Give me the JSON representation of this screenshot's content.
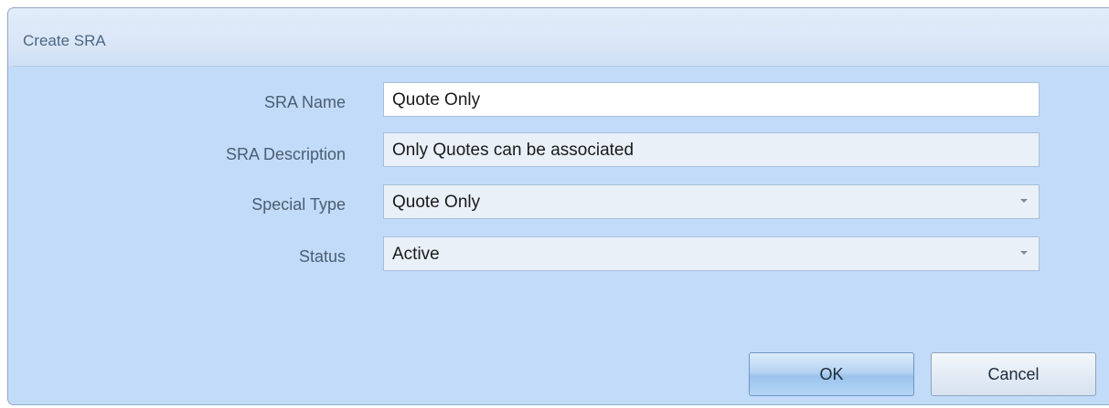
{
  "dialog": {
    "title": "Create SRA"
  },
  "form": {
    "sra_name": {
      "label": "SRA Name",
      "value": "Quote Only"
    },
    "sra_description": {
      "label": "SRA Description",
      "value": "Only Quotes can be associated"
    },
    "special_type": {
      "label": "Special Type",
      "value": "Quote Only"
    },
    "status": {
      "label": "Status",
      "value": "Active"
    }
  },
  "buttons": {
    "ok_label": "OK",
    "cancel_label": "Cancel"
  },
  "icons": {
    "combo_arrow": "chevron-down-icon"
  },
  "colors": {
    "dialog_background": "#c2dcf7",
    "titlebar_text": "#4a6785",
    "label_text": "#4b5e72",
    "ok_button_accent": "#9ac3ec"
  }
}
